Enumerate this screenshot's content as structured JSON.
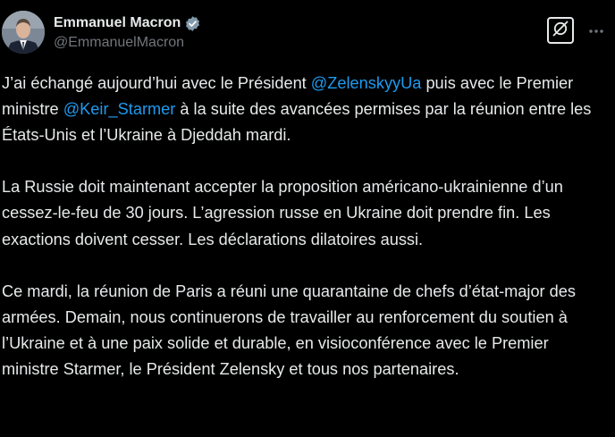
{
  "author": {
    "display_name": "Emmanuel Macron",
    "handle": "@EmmanuelMacron",
    "avatar_icon": "profile-photo",
    "verified_icon": "verified-badge-icon",
    "verified_color": "#829aab"
  },
  "actions": {
    "grok_icon": "grok-icon",
    "more_icon": "more-options-icon"
  },
  "tweet": {
    "p1_a": "J’ai échangé aujourd’hui avec le Président ",
    "p1_mention1": "@ZelenskyyUa",
    "p1_b": " puis avec le Premier ministre ",
    "p1_mention2": "@Keir_Starmer",
    "p1_c": " à la suite des avancées permises par la réunion entre les États-Unis et l’Ukraine à Djeddah mardi.",
    "p2": "La Russie doit maintenant accepter la proposition américano-ukrainienne d’un cessez-le-feu de 30 jours. L’agression russe en Ukraine doit prendre fin. Les exactions doivent cesser. Les déclarations dilatoires aussi.",
    "p3": "Ce mardi, la réunion de Paris a réuni une quarantaine de chefs d’état-major des armées. Demain, nous continuerons de travailler au renforcement du soutien à l’Ukraine et à une paix solide et durable, en visioconférence avec le Premier ministre Starmer, le Président Zelensky et tous nos partenaires."
  },
  "colors": {
    "background": "#000000",
    "text": "#e7e9ea",
    "secondary_text": "#71767b",
    "link": "#1d9bf0"
  }
}
